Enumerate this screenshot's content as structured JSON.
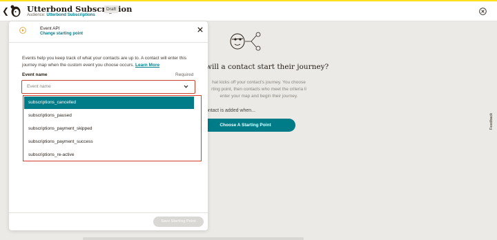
{
  "header": {
    "title": "Utterbond Subscription",
    "status_badge": "Draft",
    "audience_label": "Audience:",
    "audience_value": "Utterbond Subscriptions"
  },
  "background": {
    "question": "will a contact start their journey?",
    "description": "hat kicks off your contact's journey. You choose rting point, then contacts who meet the criteria ll enter your map and begin their journey.",
    "when_text": "ontact is added when...",
    "choose_button": "Choose A Starting Point",
    "feedback_label": "Feedback"
  },
  "panel": {
    "title": "Event API",
    "change_link": "Change starting point",
    "description_text": "Events help you keep track of what your contacts are up to. A contact will enter this journey map when the custom event you choose occurs.",
    "learn_more": "Learn More",
    "field_label": "Event name",
    "field_required": "Required",
    "field_placeholder": "Event name",
    "options": [
      "subscriptions_cancelled",
      "subscriptions_paused",
      "subscriptions_payment_skipped",
      "subscriptions_payment_success",
      "subscriptions_re-active"
    ],
    "selected_option": "subscriptions_cancelled",
    "save_button": "Save Starting Point"
  },
  "colors": {
    "accent": "#007c89",
    "brand_yellow": "#ffe01b",
    "error_red": "#d63b28"
  }
}
